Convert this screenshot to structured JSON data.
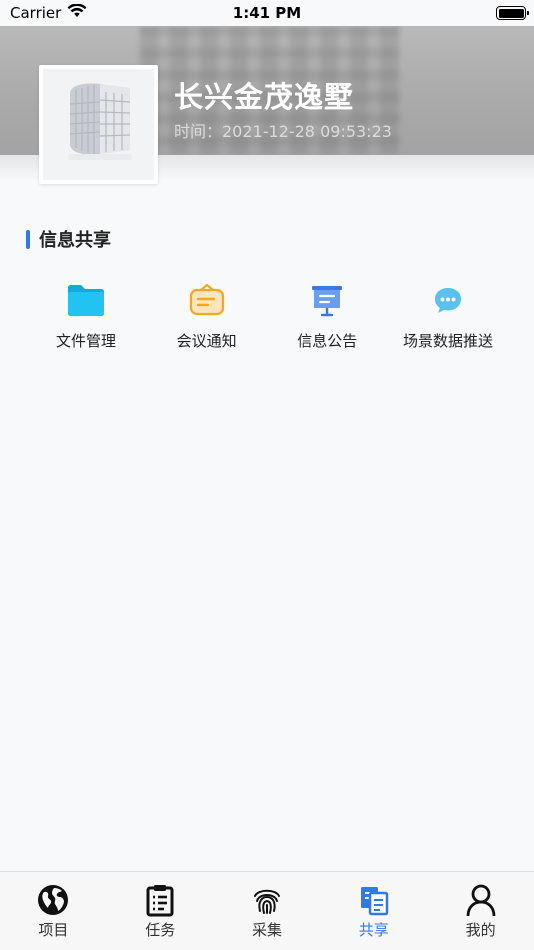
{
  "status_bar": {
    "carrier": "Carrier",
    "time": "1:41 PM"
  },
  "project": {
    "title": "长兴金茂逸墅",
    "time": "时间：2021-12-28 09:53:23"
  },
  "section": {
    "title": "信息共享"
  },
  "features": [
    {
      "label": "文件管理",
      "icon": "folder-icon"
    },
    {
      "label": "会议通知",
      "icon": "meeting-notice-icon"
    },
    {
      "label": "信息公告",
      "icon": "announcement-board-icon"
    },
    {
      "label": "场景数据推送",
      "icon": "chat-bubble-icon"
    }
  ],
  "tabbar": {
    "active": "share",
    "items": [
      {
        "key": "project",
        "label": "项目",
        "icon": "globe-icon"
      },
      {
        "key": "task",
        "label": "任务",
        "icon": "clipboard-icon"
      },
      {
        "key": "collect",
        "label": "采集",
        "icon": "fingerprint-icon"
      },
      {
        "key": "share",
        "label": "共享",
        "icon": "share-documents-icon"
      },
      {
        "key": "mine",
        "label": "我的",
        "icon": "user-icon"
      }
    ]
  },
  "colors": {
    "accent": "#2f7be6",
    "folder": "#1bb6e8",
    "meeting": "#f5a623",
    "announcement": "#4a86e8",
    "chat": "#5bc0eb"
  }
}
